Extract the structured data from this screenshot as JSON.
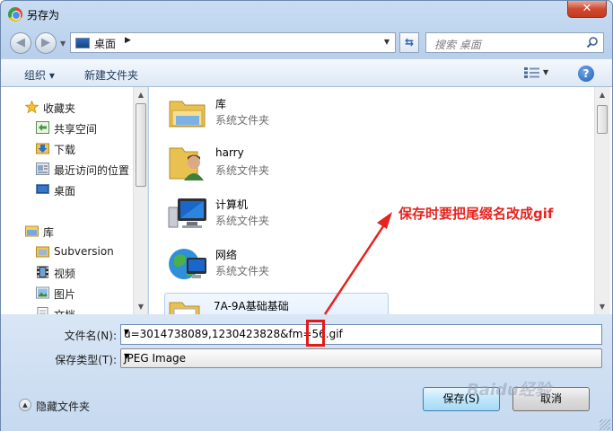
{
  "window": {
    "title": "另存为",
    "close_label": "✕"
  },
  "nav": {
    "back_glyph": "◀",
    "forward_glyph": "▶",
    "address_text": "桌面",
    "address_arrow": "▶",
    "search_placeholder": "搜索 桌面"
  },
  "toolbar": {
    "organize_label": "组织 ▾",
    "new_folder_label": "新建文件夹",
    "help_label": "?"
  },
  "sidebar": {
    "favorites_label": "收藏夹",
    "items": [
      {
        "label": "共享空间",
        "icon": "shared-space-icon"
      },
      {
        "label": "下载",
        "icon": "download-folder-icon"
      },
      {
        "label": "最近访问的位置",
        "icon": "recent-places-icon"
      },
      {
        "label": "桌面",
        "icon": "desktop-icon"
      }
    ],
    "library_label": "库",
    "library_items": [
      {
        "label": "Subversion",
        "icon": "subversion-icon"
      },
      {
        "label": "视频",
        "icon": "video-icon"
      },
      {
        "label": "图片",
        "icon": "pictures-icon"
      },
      {
        "label": "文档",
        "icon": "documents-icon"
      }
    ]
  },
  "files": [
    {
      "name": "库",
      "type": "系统文件夹",
      "icon": "library-folder-icon"
    },
    {
      "name": "harry",
      "type": "系统文件夹",
      "icon": "user-folder-icon"
    },
    {
      "name": "计算机",
      "type": "系统文件夹",
      "icon": "computer-icon"
    },
    {
      "name": "网络",
      "type": "系统文件夹",
      "icon": "network-icon"
    },
    {
      "name": "7A-9A基础基础",
      "type": "",
      "icon": "folder-icon"
    }
  ],
  "annotation": "保存时要把尾缀名改成gif",
  "form": {
    "filename_label": "文件名(N):",
    "filename_value": "u=3014738089,1230423828&fm=56.gif",
    "filetype_label": "保存类型(T):",
    "filetype_value": "JPEG Image"
  },
  "footer": {
    "hide_folders_label": "隐藏文件夹",
    "save_label": "保存(S)",
    "cancel_label": "取消"
  },
  "watermark": "Baidu经验",
  "colors": {
    "annotation": "#e5241e",
    "accent": "#3c7fb1"
  }
}
